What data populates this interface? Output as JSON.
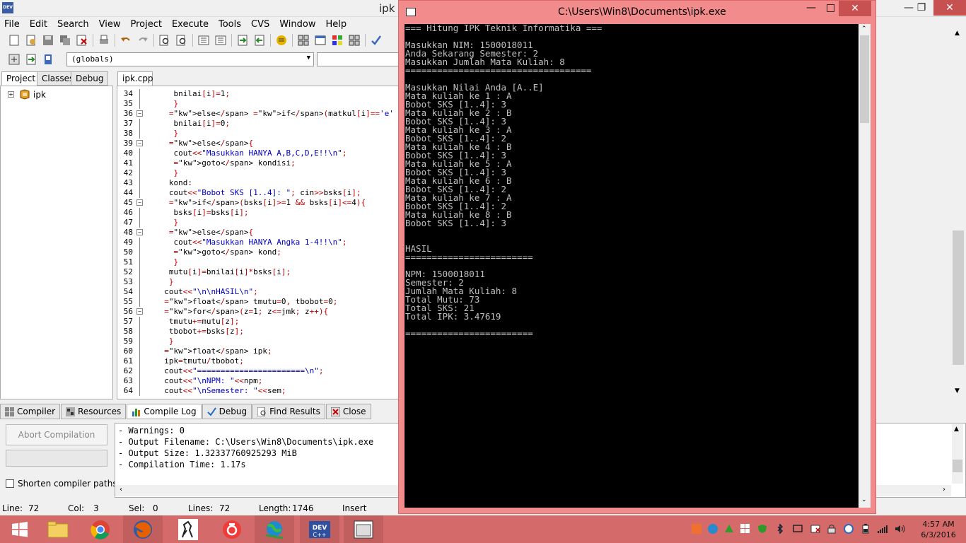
{
  "ide": {
    "title": "ipk",
    "menu": [
      "File",
      "Edit",
      "Search",
      "View",
      "Project",
      "Execute",
      "Tools",
      "CVS",
      "Window",
      "Help"
    ],
    "scope_combo": "(globals)",
    "left_tabs": [
      "Project",
      "Classes",
      "Debug"
    ],
    "tree_item": "ipk",
    "editor_tab": "ipk.cpp"
  },
  "code": [
    {
      "n": "34",
      "t": "    bnilai[i]=1;"
    },
    {
      "n": "35",
      "t": "    }"
    },
    {
      "n": "36",
      "t": "   else if(matkul[i]=='e' || matkul[i]=='E'){"
    },
    {
      "n": "37",
      "t": "    bnilai[i]=0;"
    },
    {
      "n": "38",
      "t": "    }"
    },
    {
      "n": "39",
      "t": "   else{"
    },
    {
      "n": "40",
      "t": "    cout<<\"Masukkan HANYA A,B,C,D,E!!\\n\";"
    },
    {
      "n": "41",
      "t": "    goto kondisi;"
    },
    {
      "n": "42",
      "t": "    }"
    },
    {
      "n": "43",
      "t": "   kond:"
    },
    {
      "n": "44",
      "t": "   cout<<\"Bobot SKS [1..4]: \"; cin>>bsks[i];"
    },
    {
      "n": "45",
      "t": "   if(bsks[i]>=1 && bsks[i]<=4){"
    },
    {
      "n": "46",
      "t": "    bsks[i]=bsks[i];"
    },
    {
      "n": "47",
      "t": "    }"
    },
    {
      "n": "48",
      "t": "   else{"
    },
    {
      "n": "49",
      "t": "    cout<<\"Masukkan HANYA Angka 1-4!!\\n\";"
    },
    {
      "n": "50",
      "t": "    goto kond;"
    },
    {
      "n": "51",
      "t": "    }"
    },
    {
      "n": "52",
      "t": "   mutu[i]=bnilai[i]*bsks[i];"
    },
    {
      "n": "53",
      "t": "   }"
    },
    {
      "n": "54",
      "t": "  cout<<\"\\n\\nHASIL\\n\";"
    },
    {
      "n": "55",
      "t": "  float tmutu=0, tbobot=0;"
    },
    {
      "n": "56",
      "t": "  for(z=1; z<=jmk; z++){"
    },
    {
      "n": "57",
      "t": "   tmutu+=mutu[z];"
    },
    {
      "n": "58",
      "t": "   tbobot+=bsks[z];"
    },
    {
      "n": "59",
      "t": "   }"
    },
    {
      "n": "60",
      "t": "  float ipk;"
    },
    {
      "n": "61",
      "t": "  ipk=tmutu/tbobot;"
    },
    {
      "n": "62",
      "t": "  cout<<\"=======================\\n\";"
    },
    {
      "n": "63",
      "t": "  cout<<\"\\nNPM: \"<<npm;"
    },
    {
      "n": "64",
      "t": "  cout<<\"\\nSemester: \"<<sem;"
    }
  ],
  "bottom_tabs": [
    "Compiler",
    "Resources",
    "Compile Log",
    "Debug",
    "Find Results",
    "Close"
  ],
  "abort_label": "Abort Compilation",
  "shorten_label": "Shorten compiler paths",
  "log": [
    "- Warnings: 0",
    "- Output Filename: C:\\Users\\Win8\\Documents\\ipk.exe",
    "- Output Size: 1.32337760925293 MiB",
    "- Compilation Time: 1.17s"
  ],
  "status": {
    "line_label": "Line:",
    "line": "72",
    "col_label": "Col:",
    "col": "3",
    "sel_label": "Sel:",
    "sel": "0",
    "lines_label": "Lines:",
    "lines": "72",
    "length_label": "Length:",
    "length": "1746",
    "mode": "Insert"
  },
  "console": {
    "title": "C:\\Users\\Win8\\Documents\\ipk.exe",
    "lines": [
      "=== Hitung IPK Teknik Informatika ===",
      "",
      "Masukkan NIM: 1500018011",
      "Anda Sekarang Semester: 2",
      "Masukkan Jumlah Mata Kuliah: 8",
      "===================================",
      "",
      "Masukkan Nilai Anda [A..E]",
      "Mata kuliah ke 1 : A",
      "Bobot SKS [1..4]: 3",
      "Mata kuliah ke 2 : B",
      "Bobot SKS [1..4]: 3",
      "Mata kuliah ke 3 : A",
      "Bobot SKS [1..4]: 2",
      "Mata kuliah ke 4 : B",
      "Bobot SKS [1..4]: 3",
      "Mata kuliah ke 5 : A",
      "Bobot SKS [1..4]: 3",
      "Mata kuliah ke 6 : B",
      "Bobot SKS [1..4]: 2",
      "Mata kuliah ke 7 : A",
      "Bobot SKS [1..4]: 2",
      "Mata kuliah ke 8 : B",
      "Bobot SKS [1..4]: 3",
      "",
      "",
      "HASIL",
      "========================",
      "",
      "NPM: 1500018011",
      "Semester: 2",
      "Jumlah Mata Kuliah: 8",
      "Total Mutu: 73",
      "Total SKS: 21",
      "Total IPK: 3.47619",
      "",
      "========================"
    ]
  },
  "clock": {
    "time": "4:57 AM",
    "date": "6/3/2016"
  },
  "colors": {
    "console_frame": "#f28b8b",
    "taskbar": "#d46a6a",
    "console_bg": "#000000",
    "console_text": "#c0c0c0"
  }
}
